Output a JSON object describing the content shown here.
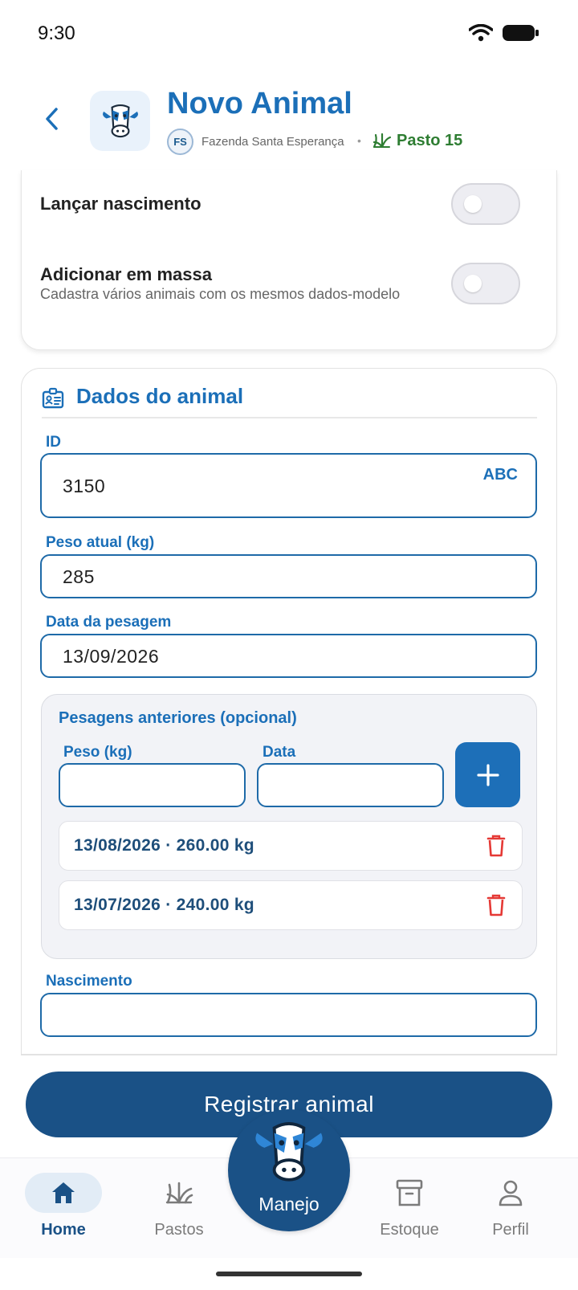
{
  "status_bar": {
    "time": "9:30"
  },
  "header": {
    "title": "Novo Animal",
    "farm_initials": "FS",
    "farm_name": "Fazenda Santa Esperança",
    "separator": "•",
    "pasture": "Pasto 15"
  },
  "options": {
    "birth_label": "Lançar nascimento",
    "birth_enabled": false,
    "bulk_label": "Adicionar em massa",
    "bulk_sub": "Cadastra vários animais com os mesmos dados-modelo",
    "bulk_enabled": false
  },
  "animal_data": {
    "section_title": "Dados do animal",
    "id_label": "ID",
    "id_value": "3150",
    "id_keyboard_hint": "ABC",
    "weight_label": "Peso atual (kg)",
    "weight_value": "285",
    "weigh_date_label": "Data da pesagem",
    "weigh_date_value": "13/09/2026",
    "previous": {
      "title": "Pesagens anteriores (opcional)",
      "weight_label": "Peso (kg)",
      "date_label": "Data",
      "weight_value": "",
      "date_value": "",
      "entries": [
        {
          "text": "13/08/2026 · 260.00 kg"
        },
        {
          "text": "13/07/2026 · 240.00 kg"
        }
      ]
    },
    "birth_label": "Nascimento",
    "birth_value": ""
  },
  "register_button": "Registrar animal",
  "nav": {
    "home": "Home",
    "pastures": "Pastos",
    "manejo": "Manejo",
    "stock": "Estoque",
    "profile": "Perfil",
    "active": "home"
  },
  "colors": {
    "primary": "#1b6fb8",
    "dark_primary": "#1a5186",
    "pasture_green": "#2e7d32",
    "delete_red": "#e53935"
  }
}
